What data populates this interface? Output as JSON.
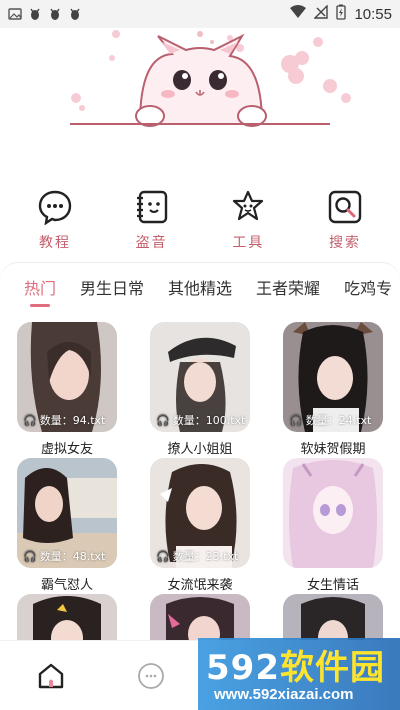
{
  "status_bar": {
    "time": "10:55",
    "battery_icon": "battery-icon",
    "wifi_icon": "wifi-icon"
  },
  "categories": [
    {
      "label": "教程",
      "icon": "chat-icon"
    },
    {
      "label": "盗音",
      "icon": "notebook-icon"
    },
    {
      "label": "工具",
      "icon": "star-face-icon"
    },
    {
      "label": "搜索",
      "icon": "search-icon"
    }
  ],
  "tabs": [
    {
      "label": "热门",
      "active": true
    },
    {
      "label": "男生日常",
      "active": false
    },
    {
      "label": "其他精选",
      "active": false
    },
    {
      "label": "王者荣耀",
      "active": false
    },
    {
      "label": "吃鸡专",
      "active": false
    }
  ],
  "cards": [
    {
      "title": "虚拟女友",
      "count": "数量：94.txt"
    },
    {
      "title": "撩人小姐姐",
      "count": "数量：100.txt"
    },
    {
      "title": "软妹贺假期",
      "count": "数量：24.txt"
    },
    {
      "title": "霸气怼人",
      "count": "数量：48.txt"
    },
    {
      "title": "女流氓来袭",
      "count": "数量：23.txt"
    },
    {
      "title": "女生情话",
      "count": ""
    },
    {
      "title": "",
      "count": ""
    },
    {
      "title": "",
      "count": ""
    },
    {
      "title": "",
      "count": ""
    }
  ],
  "watermark": {
    "brand_num": "592",
    "brand_cn": "软件园",
    "url": "www.592xiazai.com"
  },
  "colors": {
    "accent": "#e06c7c",
    "label": "#c4606d"
  }
}
